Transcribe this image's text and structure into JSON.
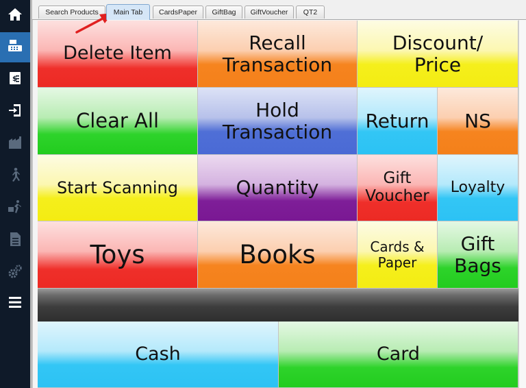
{
  "sidebar": {
    "items": [
      {
        "icon": "home-icon"
      },
      {
        "icon": "cash-register-icon"
      },
      {
        "icon": "receipt-icon"
      },
      {
        "icon": "login-icon"
      },
      {
        "icon": "building-icon"
      },
      {
        "icon": "person-walking-icon"
      },
      {
        "icon": "delivery-icon"
      },
      {
        "icon": "report-icon"
      },
      {
        "icon": "gears-icon"
      },
      {
        "icon": "menu-icon"
      }
    ],
    "active_index": 1,
    "active_color": "#2a6fb2",
    "background": "#0f1a29"
  },
  "tabs": [
    {
      "label": "Search Products"
    },
    {
      "label": "Main Tab"
    },
    {
      "label": "CardsPaper"
    },
    {
      "label": "GiftBag"
    },
    {
      "label": "GiftVoucher"
    },
    {
      "label": "QT2"
    }
  ],
  "active_tab": "Main Tab",
  "annotation": {
    "arrow_color": "#e02020",
    "points_to": "Main Tab"
  },
  "buttons": {
    "delete_item": "Delete Item",
    "recall_transaction": "Recall\nTransaction",
    "discount_price": "Discount/\nPrice",
    "clear_all": "Clear All",
    "hold_transaction": "Hold\nTransaction",
    "return": "Return",
    "ns": "NS",
    "start_scanning": "Start Scanning",
    "quantity": "Quantity",
    "gift_voucher": "Gift\nVoucher",
    "loyalty": "Loyalty",
    "toys": "Toys",
    "books": "Books",
    "cards_paper": "Cards &\nPaper",
    "gift_bags": "Gift\nBags",
    "cash": "Cash",
    "card": "Card"
  },
  "colors": {
    "red": "#ec2a24",
    "orange": "#f4801a",
    "yellow": "#f4ec12",
    "green": "#22cc1e",
    "blue": "#4a6ad5",
    "cyan": "#2cc2f4",
    "purple": "#7a1893"
  }
}
